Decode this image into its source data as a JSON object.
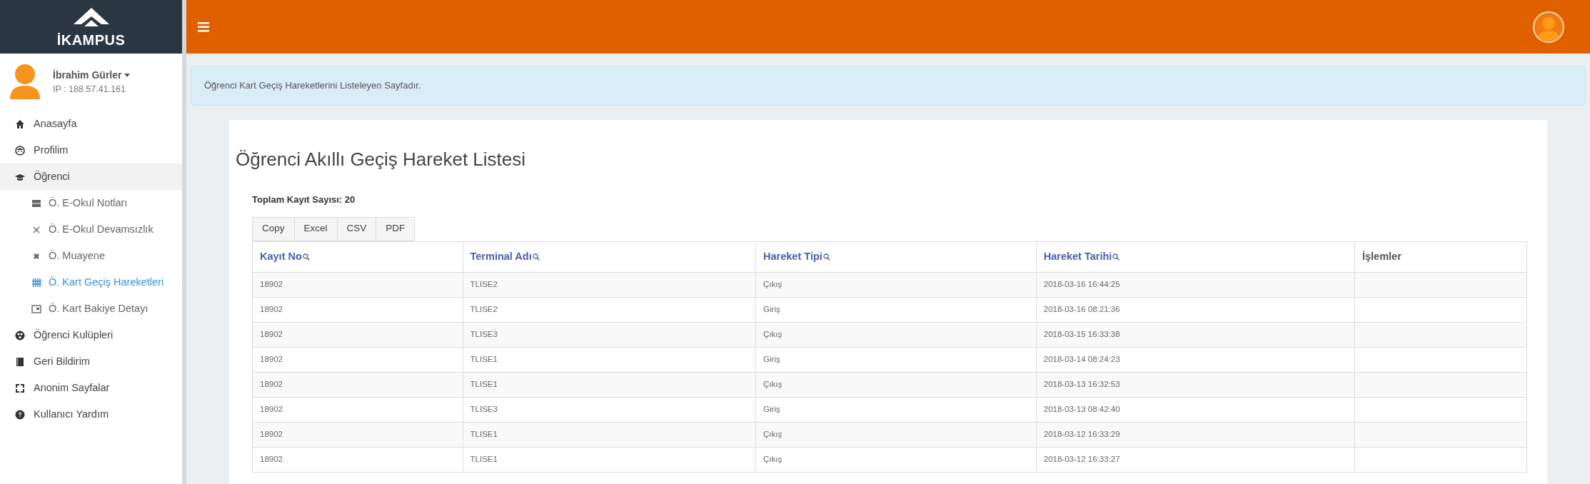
{
  "brand": {
    "name": "İKAMPUS"
  },
  "user": {
    "name": "İbrahim Gürler",
    "ip": "IP : 188.57.41.161"
  },
  "sidebar": {
    "items": [
      {
        "label": "Anasayfa",
        "selected": false
      },
      {
        "label": "Profilim",
        "selected": false
      },
      {
        "label": "Öğrenci",
        "selected": false,
        "expanded": true,
        "children": [
          {
            "label": "Ö. E-Okul Notları",
            "selected": false
          },
          {
            "label": "Ö. E-Okul Devamsızlık",
            "selected": false
          },
          {
            "label": "Ö. Muayene",
            "selected": false
          },
          {
            "label": "Ö. Kart Geçiş Hareketleri",
            "selected": true
          },
          {
            "label": "Ö. Kart Bakiye Detayı",
            "selected": false
          }
        ]
      },
      {
        "label": "Öğrenci Kulüpleri",
        "selected": false
      },
      {
        "label": "Geri Bildirim",
        "selected": false
      },
      {
        "label": "Anonim Sayfalar",
        "selected": false
      },
      {
        "label": "Kullanıcı Yardım",
        "selected": false
      }
    ]
  },
  "info_alert": "Öğrenci Kart Geçiş Hareketlerini Listeleyen Sayfadır.",
  "page_title": "Öğrenci Akıllı Geçiş Hareket Listesi",
  "total_count": "Toplam Kayıt Sayısı: 20",
  "export_buttons": [
    "Copy",
    "Excel",
    "CSV",
    "PDF"
  ],
  "table": {
    "columns": [
      {
        "label": "Kayıt No",
        "filterable": true
      },
      {
        "label": "Terminal Adı",
        "filterable": true
      },
      {
        "label": "Hareket Tipi",
        "filterable": true
      },
      {
        "label": "Hareket Tarihi",
        "filterable": true
      },
      {
        "label": "İşlemler",
        "filterable": false
      }
    ],
    "rows": [
      [
        "18902",
        "TLISE2",
        "Çıkış",
        "2018-03-16 16:44:25",
        ""
      ],
      [
        "18902",
        "TLISE2",
        "Giriş",
        "2018-03-16 08:21:36",
        ""
      ],
      [
        "18902",
        "TLISE3",
        "Çıkış",
        "2018-03-15 16:33:38",
        ""
      ],
      [
        "18902",
        "TLISE1",
        "Giriş",
        "2018-03-14 08:24:23",
        ""
      ],
      [
        "18902",
        "TLISE1",
        "Çıkış",
        "2018-03-13 16:32:53",
        ""
      ],
      [
        "18902",
        "TLISE3",
        "Giriş",
        "2018-03-13 08:42:40",
        ""
      ],
      [
        "18902",
        "TLISE1",
        "Çıkış",
        "2018-03-12 16:33:29",
        ""
      ],
      [
        "18902",
        "TLISE1",
        "Çıkış",
        "2018-03-12 16:33:27",
        ""
      ]
    ]
  }
}
